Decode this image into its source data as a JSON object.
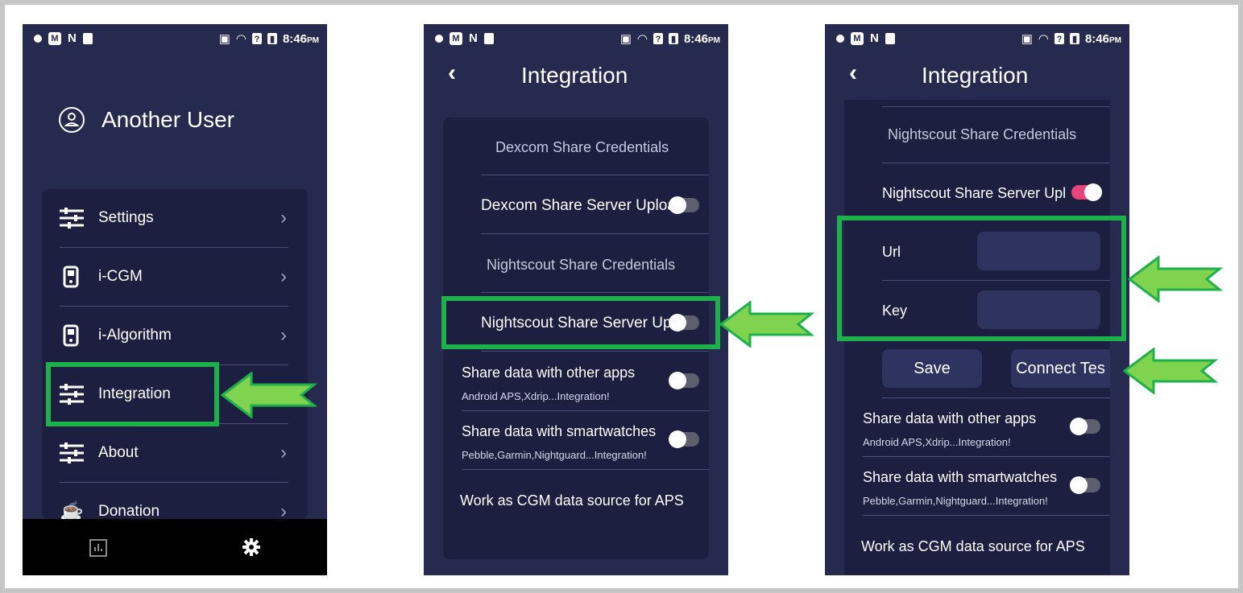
{
  "status_bar": {
    "time": "8:46",
    "ampm": "PM"
  },
  "screen1": {
    "user_name": "Another User",
    "menu": [
      {
        "label": "Settings",
        "icon": "sliders-icon"
      },
      {
        "label": "i-CGM",
        "icon": "sensor-icon"
      },
      {
        "label": "i-Algorithm",
        "icon": "sensor-icon"
      },
      {
        "label": "Integration",
        "icon": "sliders-icon"
      },
      {
        "label": "About",
        "icon": "sliders-icon"
      },
      {
        "label": "Donation",
        "icon": "coffee-icon"
      }
    ]
  },
  "screen2": {
    "title": "Integration",
    "dexcom_header": "Dexcom Share Credentials",
    "dexcom_upload": "Dexcom Share Server Uploa",
    "nightscout_header": "Nightscout Share Credentials",
    "nightscout_upload": "Nightscout Share Server Upl",
    "share_apps": "Share data with other apps",
    "share_apps_sub": "Android APS,Xdrip...Integration!",
    "share_watch": "Share data with smartwatches",
    "share_watch_sub": "Pebble,Garmin,Nightguard...Integration!",
    "cgm_source": "Work as CGM data source for APS"
  },
  "screen3": {
    "title": "Integration",
    "nightscout_header": "Nightscout Share Credentials",
    "nightscout_upload": "Nightscout Share Server Upl",
    "url_label": "Url",
    "key_label": "Key",
    "save": "Save",
    "connect_test": "Connect Tes",
    "share_apps": "Share data with other apps",
    "share_apps_sub": "Android APS,Xdrip...Integration!",
    "share_watch": "Share data with smartwatches",
    "share_watch_sub": "Pebble,Garmin,Nightguard...Integration!",
    "cgm_source": "Work as CGM data source for APS"
  },
  "colors": {
    "highlight": "#1db04b",
    "arrow_fill": "#7fd34e",
    "toggle_on": "#e8457b",
    "background": "#262a4e"
  }
}
